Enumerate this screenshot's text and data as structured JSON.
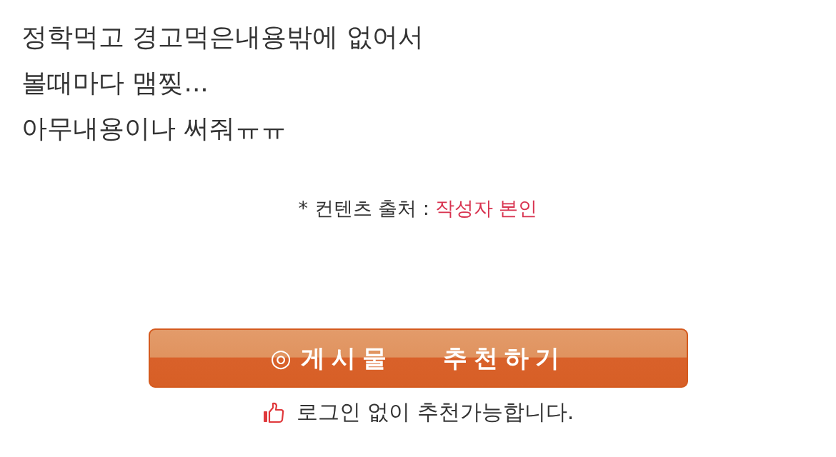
{
  "post_lines": [
    "정학먹고 경고먹은내용밖에 없어서",
    "볼때마다 맴찢...",
    "아무내용이나 써줘ㅠㅠ"
  ],
  "source": {
    "label": "* 컨텐츠 출처 :",
    "value": "작성자 본인"
  },
  "recommend_button": {
    "icon": "◎",
    "label": "게시물  추천하기"
  },
  "recommend_note": "로그인 없이 추천가능합니다."
}
